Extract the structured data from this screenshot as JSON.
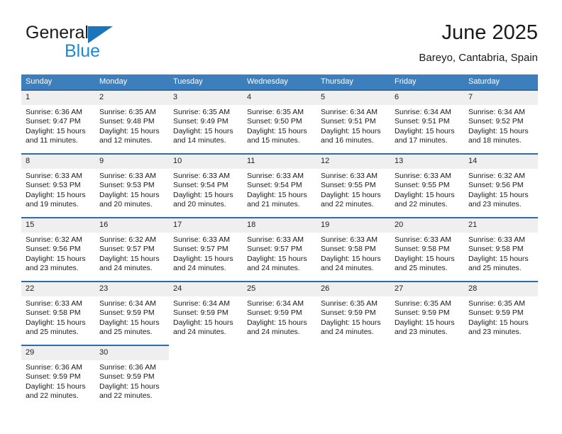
{
  "brand": {
    "name_part1": "General",
    "name_part2": "Blue",
    "flag_icon": "blue-triangle-flag-icon"
  },
  "header": {
    "title": "June 2025",
    "location": "Bareyo, Cantabria, Spain"
  },
  "calendar": {
    "weekday_headers": [
      "Sunday",
      "Monday",
      "Tuesday",
      "Wednesday",
      "Thursday",
      "Friday",
      "Saturday"
    ],
    "header_bg": "#3d7ebd",
    "row_separator_color": "#2c6cad",
    "daynum_bg": "#efefef",
    "weeks": [
      [
        {
          "day": "1",
          "info": "Sunrise: 6:36 AM\nSunset: 9:47 PM\nDaylight: 15 hours\nand 11 minutes."
        },
        {
          "day": "2",
          "info": "Sunrise: 6:35 AM\nSunset: 9:48 PM\nDaylight: 15 hours\nand 12 minutes."
        },
        {
          "day": "3",
          "info": "Sunrise: 6:35 AM\nSunset: 9:49 PM\nDaylight: 15 hours\nand 14 minutes."
        },
        {
          "day": "4",
          "info": "Sunrise: 6:35 AM\nSunset: 9:50 PM\nDaylight: 15 hours\nand 15 minutes."
        },
        {
          "day": "5",
          "info": "Sunrise: 6:34 AM\nSunset: 9:51 PM\nDaylight: 15 hours\nand 16 minutes."
        },
        {
          "day": "6",
          "info": "Sunrise: 6:34 AM\nSunset: 9:51 PM\nDaylight: 15 hours\nand 17 minutes."
        },
        {
          "day": "7",
          "info": "Sunrise: 6:34 AM\nSunset: 9:52 PM\nDaylight: 15 hours\nand 18 minutes."
        }
      ],
      [
        {
          "day": "8",
          "info": "Sunrise: 6:33 AM\nSunset: 9:53 PM\nDaylight: 15 hours\nand 19 minutes."
        },
        {
          "day": "9",
          "info": "Sunrise: 6:33 AM\nSunset: 9:53 PM\nDaylight: 15 hours\nand 20 minutes."
        },
        {
          "day": "10",
          "info": "Sunrise: 6:33 AM\nSunset: 9:54 PM\nDaylight: 15 hours\nand 20 minutes."
        },
        {
          "day": "11",
          "info": "Sunrise: 6:33 AM\nSunset: 9:54 PM\nDaylight: 15 hours\nand 21 minutes."
        },
        {
          "day": "12",
          "info": "Sunrise: 6:33 AM\nSunset: 9:55 PM\nDaylight: 15 hours\nand 22 minutes."
        },
        {
          "day": "13",
          "info": "Sunrise: 6:33 AM\nSunset: 9:55 PM\nDaylight: 15 hours\nand 22 minutes."
        },
        {
          "day": "14",
          "info": "Sunrise: 6:32 AM\nSunset: 9:56 PM\nDaylight: 15 hours\nand 23 minutes."
        }
      ],
      [
        {
          "day": "15",
          "info": "Sunrise: 6:32 AM\nSunset: 9:56 PM\nDaylight: 15 hours\nand 23 minutes."
        },
        {
          "day": "16",
          "info": "Sunrise: 6:32 AM\nSunset: 9:57 PM\nDaylight: 15 hours\nand 24 minutes."
        },
        {
          "day": "17",
          "info": "Sunrise: 6:33 AM\nSunset: 9:57 PM\nDaylight: 15 hours\nand 24 minutes."
        },
        {
          "day": "18",
          "info": "Sunrise: 6:33 AM\nSunset: 9:57 PM\nDaylight: 15 hours\nand 24 minutes."
        },
        {
          "day": "19",
          "info": "Sunrise: 6:33 AM\nSunset: 9:58 PM\nDaylight: 15 hours\nand 24 minutes."
        },
        {
          "day": "20",
          "info": "Sunrise: 6:33 AM\nSunset: 9:58 PM\nDaylight: 15 hours\nand 25 minutes."
        },
        {
          "day": "21",
          "info": "Sunrise: 6:33 AM\nSunset: 9:58 PM\nDaylight: 15 hours\nand 25 minutes."
        }
      ],
      [
        {
          "day": "22",
          "info": "Sunrise: 6:33 AM\nSunset: 9:58 PM\nDaylight: 15 hours\nand 25 minutes."
        },
        {
          "day": "23",
          "info": "Sunrise: 6:34 AM\nSunset: 9:59 PM\nDaylight: 15 hours\nand 25 minutes."
        },
        {
          "day": "24",
          "info": "Sunrise: 6:34 AM\nSunset: 9:59 PM\nDaylight: 15 hours\nand 24 minutes."
        },
        {
          "day": "25",
          "info": "Sunrise: 6:34 AM\nSunset: 9:59 PM\nDaylight: 15 hours\nand 24 minutes."
        },
        {
          "day": "26",
          "info": "Sunrise: 6:35 AM\nSunset: 9:59 PM\nDaylight: 15 hours\nand 24 minutes."
        },
        {
          "day": "27",
          "info": "Sunrise: 6:35 AM\nSunset: 9:59 PM\nDaylight: 15 hours\nand 23 minutes."
        },
        {
          "day": "28",
          "info": "Sunrise: 6:35 AM\nSunset: 9:59 PM\nDaylight: 15 hours\nand 23 minutes."
        }
      ],
      [
        {
          "day": "29",
          "info": "Sunrise: 6:36 AM\nSunset: 9:59 PM\nDaylight: 15 hours\nand 22 minutes."
        },
        {
          "day": "30",
          "info": "Sunrise: 6:36 AM\nSunset: 9:59 PM\nDaylight: 15 hours\nand 22 minutes."
        },
        {
          "day": "",
          "info": ""
        },
        {
          "day": "",
          "info": ""
        },
        {
          "day": "",
          "info": ""
        },
        {
          "day": "",
          "info": ""
        },
        {
          "day": "",
          "info": ""
        }
      ]
    ]
  }
}
